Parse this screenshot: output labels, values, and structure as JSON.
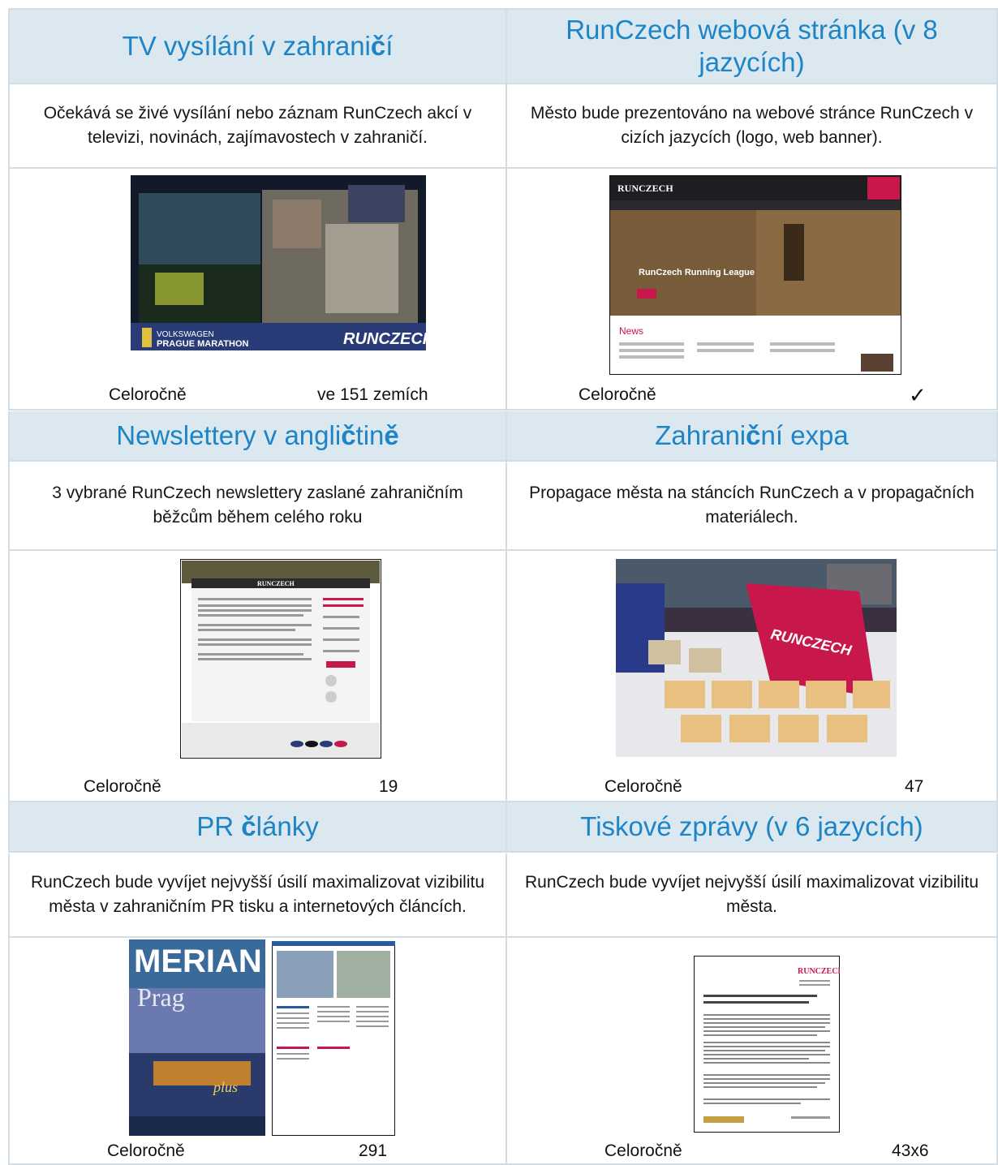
{
  "sections": [
    {
      "title_pre": "TV vysílání v zahrani",
      "title_bold": "č",
      "title_post": "í",
      "description": "Očekává se živé vysílání nebo záznam RunCzech akcí v televizi, novinách, zajímavostech v zahraničí.",
      "caption_label": "Celoročně",
      "caption_value": "ve 151 zemích",
      "image": {
        "brand_left_top": "VOLKSWAGEN",
        "brand_left_bottom": "PRAGUE MARATHON",
        "brand_right": "RUNCZECH"
      }
    },
    {
      "title_pre": "RunCzech webová stránka (v 8 jazycích)",
      "title_bold": "",
      "title_post": "",
      "description": "Město bude prezentováno na webové stránce RunCzech v cizích jazycích (logo, web banner).",
      "caption_label": "Celoročně",
      "caption_value": "✓",
      "image": {
        "logo": "RUNCZECH",
        "banner_title": "RunCzech Running League",
        "news_heading": "News"
      }
    },
    {
      "title_pre": "Newslettery v angli",
      "title_bold": "č",
      "title_mid": "tin",
      "title_bold2": "ě",
      "description": "3 vybrané RunCzech newslettery zaslané zahraničním běžcům během celého roku",
      "caption_label": "Celoročně",
      "caption_value": "19",
      "image": {
        "logo": "RUNCZECH"
      }
    },
    {
      "title_pre": "Zahrani",
      "title_bold": "č",
      "title_post": "ní expa",
      "description": "Propagace města na stáncích RunCzech a v propagačních materiálech.",
      "caption_label": "Celoročně",
      "caption_value": "47",
      "image": {
        "banner": "RUNCZECH"
      }
    },
    {
      "title_pre": "PR ",
      "title_bold": "č",
      "title_post": "lánky",
      "description": "RunCzech bude vyvíjet nejvyšší úsilí maximalizovat vizibilitu města v zahraničním PR tisku a internetových článcích.",
      "caption_label": "Celoročně",
      "caption_value": "291",
      "image": {
        "magazine_title": "MERIAN",
        "magazine_subtitle": "Prag",
        "magazine_badge": "plus"
      }
    },
    {
      "title_pre": "Tiskové zprávy (v 6 jazycích)",
      "title_bold": "",
      "title_post": "",
      "description": "RunCzech bude vyvíjet nejvyšší úsilí maximalizovat vizibilitu města.",
      "caption_label": "Celoročně",
      "caption_value": "43x6",
      "image": {
        "logo": "RUNCZECH"
      }
    }
  ],
  "colors": {
    "accent": "#1e84c6",
    "header_bg": "#dbe8ef",
    "border": "#d4dde3",
    "brand_red": "#c8174a"
  }
}
